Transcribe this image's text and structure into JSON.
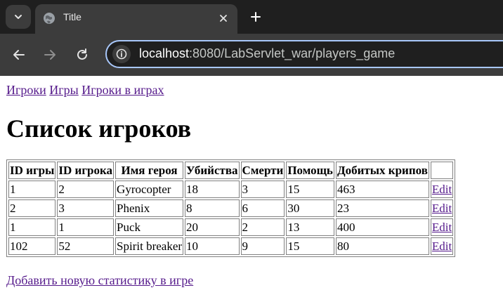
{
  "browser": {
    "tab_title": "Title",
    "url_host": "localhost",
    "url_rest": ":8080/LabServlet_war/players_game"
  },
  "nav": [
    {
      "label": "Игроки"
    },
    {
      "label": "Игры"
    },
    {
      "label": "Игроки в играх"
    }
  ],
  "page_title": "Список игроков",
  "table": {
    "headers": [
      "ID игры",
      "ID игрока",
      "Имя героя",
      "Убийства",
      "Смерти",
      "Помощь",
      "Добитых крипов",
      ""
    ],
    "rows": [
      {
        "game_id": "1",
        "player_id": "2",
        "hero": "Gyrocopter",
        "kills": "18",
        "deaths": "3",
        "assists": "15",
        "creeps": "463",
        "edit": "Edit"
      },
      {
        "game_id": "2",
        "player_id": "3",
        "hero": "Phenix",
        "kills": "8",
        "deaths": "6",
        "assists": "30",
        "creeps": "23",
        "edit": "Edit"
      },
      {
        "game_id": "1",
        "player_id": "1",
        "hero": "Puck",
        "kills": "20",
        "deaths": "2",
        "assists": "13",
        "creeps": "400",
        "edit": "Edit"
      },
      {
        "game_id": "102",
        "player_id": "52",
        "hero": "Spirit breaker",
        "kills": "10",
        "deaths": "9",
        "assists": "15",
        "creeps": "80",
        "edit": "Edit"
      }
    ]
  },
  "add_link": "Добавить новую статистику в игре",
  "icons": {
    "tab_menu": "chevron-down-icon",
    "favicon": "globe-icon",
    "close": "close-icon",
    "new_tab": "plus-icon",
    "back": "back-arrow-icon",
    "forward": "forward-arrow-icon",
    "reload": "reload-icon",
    "site_info": "site-info-icon"
  }
}
